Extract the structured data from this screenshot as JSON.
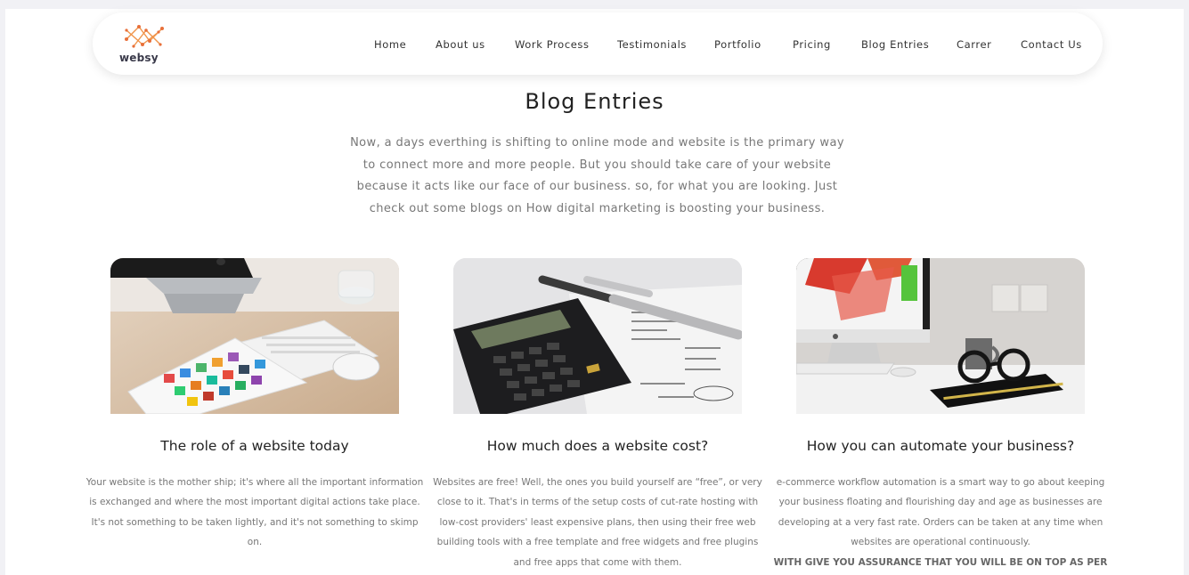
{
  "logo": {
    "text": "websy"
  },
  "nav": {
    "items": [
      {
        "label": "Home"
      },
      {
        "label": "About us"
      },
      {
        "label": "Work Process"
      },
      {
        "label": "Testimonials"
      },
      {
        "label": "Portfolio"
      },
      {
        "label": "Pricing"
      },
      {
        "label": "Blog Entries"
      },
      {
        "label": "Carrer"
      },
      {
        "label": "Contact Us"
      }
    ]
  },
  "blog": {
    "title": "Blog Entries",
    "intro": "Now, a days everthing is shifting to online mode and website is the primary way to connect more and more people. But you should take care of your website because it acts like our face of our business. so, for what you are looking. Just check out some blogs on How digital marketing is boosting your business.",
    "posts": [
      {
        "title": "The role of a website today",
        "body": "Your website is the mother ship; it's where all the important information is exchanged and where the most important digital actions take place. It's not something to be taken lightly, and it's not something to skimp on.",
        "image": "desk-tablet-keyboard-image"
      },
      {
        "title": "How much does a website cost?",
        "body": "Websites are free! Well, the ones you build yourself are “free”, or very close to it. That's in terms of the setup costs of cut-rate hosting with low-cost providers' least expensive plans, then using their free web building tools with a free template and free widgets and free plugins and free apps that come with them.",
        "image": "calculator-pen-paper-image"
      },
      {
        "title": "How you can automate your business?",
        "body": "e-commerce workflow automation is a smart way to go about keeping your business floating and flourishing day and age as businesses are developing at a very fast rate. Orders can be taken at any time when websites are operational continuously.",
        "emphasis": "WITH GIVE YOU ASSURANCE THAT YOU WILL BE ON TOP AS PER",
        "image": "desktop-monitor-glasses-image"
      }
    ]
  },
  "colors": {
    "background": "#f1f1f5",
    "text_dark": "#222222",
    "text_muted": "#777777",
    "logo_orange": "#f0944a"
  }
}
